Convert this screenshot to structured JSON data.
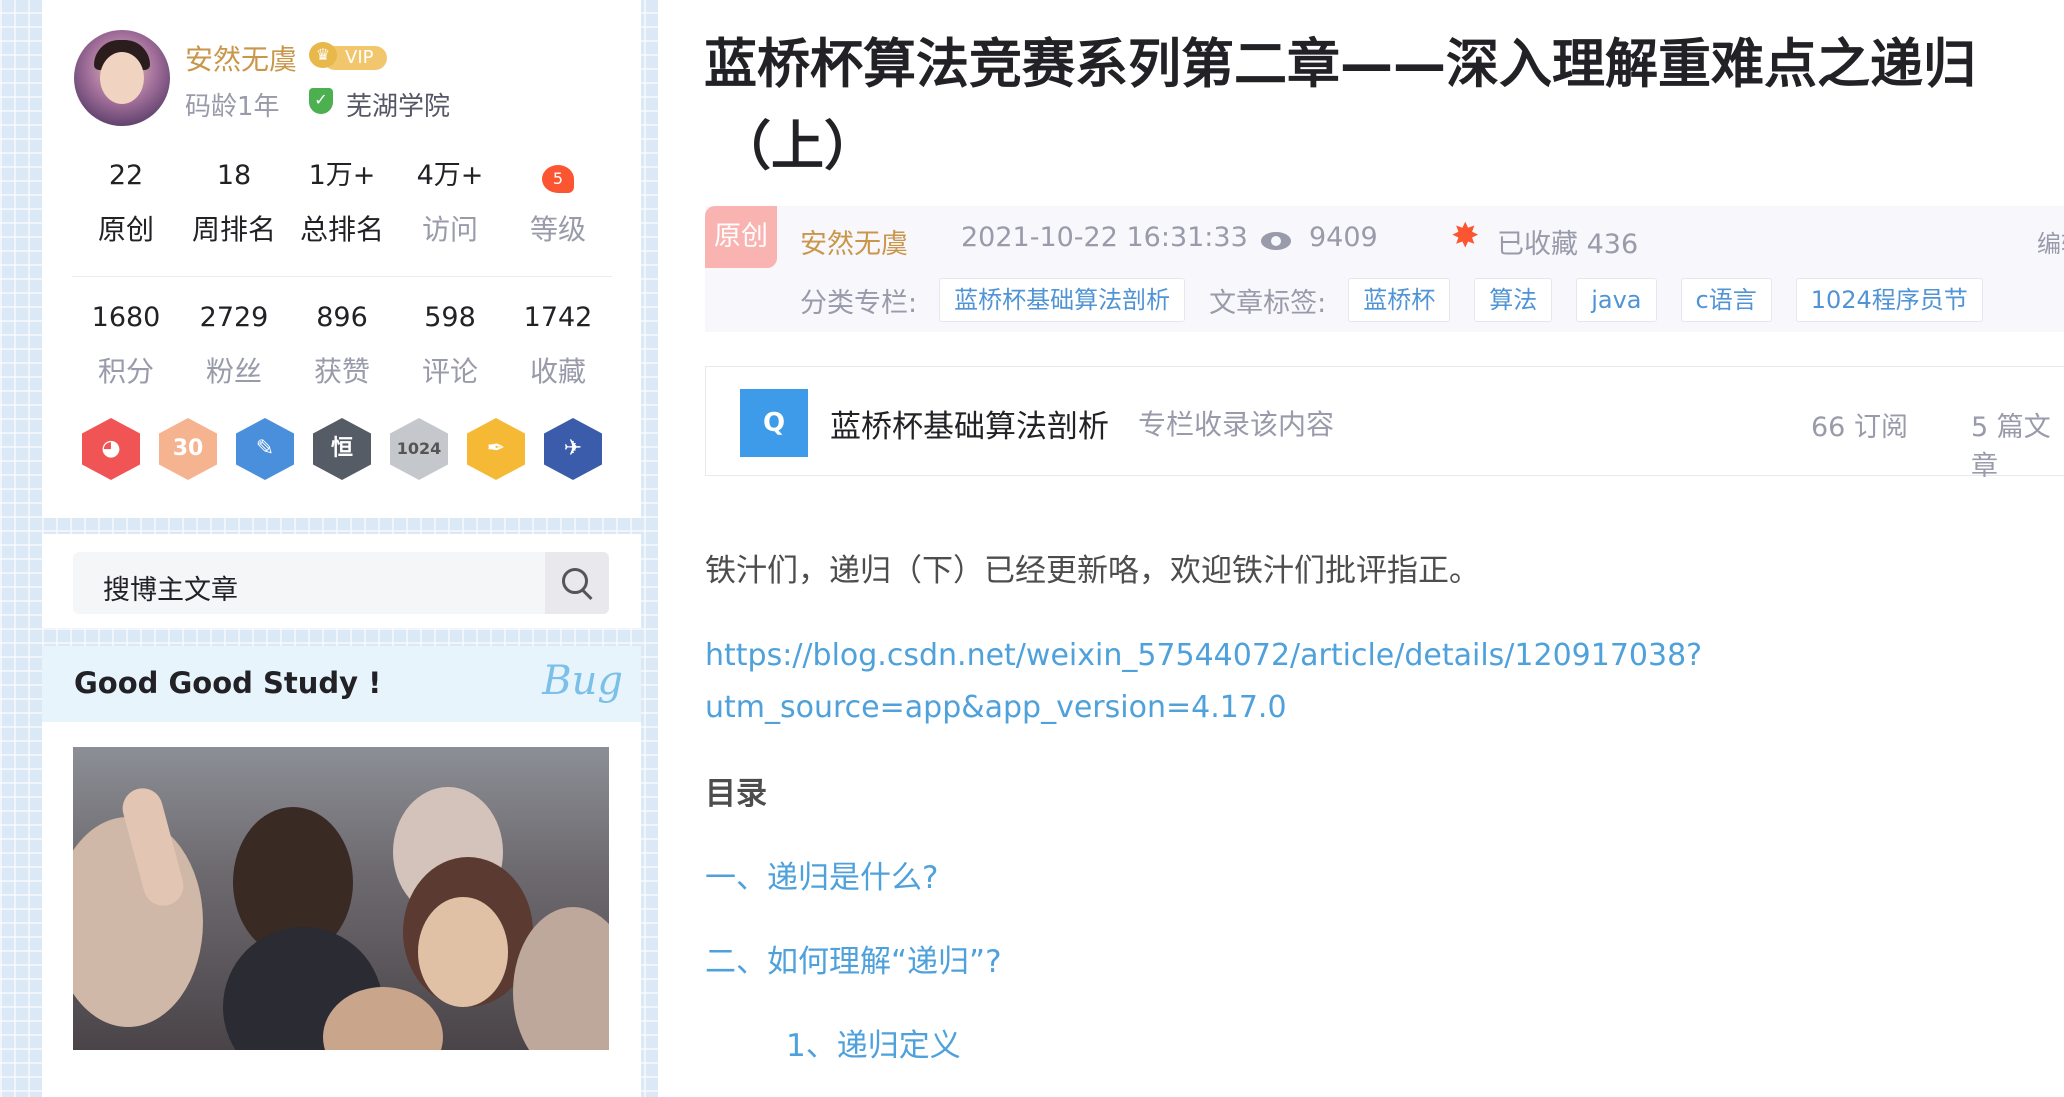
{
  "profile": {
    "name": "安然无虞",
    "vip": "VIP",
    "crown_glyph": "♛",
    "shield_glyph": "✓",
    "code_age": "码龄1年",
    "school": "芜湖学院",
    "stats_row1": [
      {
        "num": "22",
        "label": "原创"
      },
      {
        "num": "18",
        "label": "周排名"
      },
      {
        "num": "1万+",
        "label": "总排名"
      },
      {
        "num": "4万+",
        "label": "访问"
      },
      {
        "num": "",
        "label": "等级"
      }
    ],
    "stats_row2": [
      {
        "num": "1680",
        "label": "积分"
      },
      {
        "num": "2729",
        "label": "粉丝"
      },
      {
        "num": "896",
        "label": "获赞"
      },
      {
        "num": "598",
        "label": "评论"
      },
      {
        "num": "1742",
        "label": "收藏"
      }
    ],
    "level_icon_text": "5",
    "badges": [
      {
        "icon": "monkey-badge-icon",
        "text": "◕",
        "color": "#f05454"
      },
      {
        "icon": "anniversary-30-badge-icon",
        "text": "30",
        "color": "#f6b38f"
      },
      {
        "icon": "certificate-badge-icon",
        "text": "✎",
        "color": "#4a8fdc"
      },
      {
        "icon": "perseverance-badge-icon",
        "text": "恒",
        "color": "#565c66"
      },
      {
        "icon": "1024-badge-icon",
        "text": "1024",
        "color": "#c4c7cc"
      },
      {
        "icon": "pen-badge-icon",
        "text": "✒",
        "color": "#f5b935"
      },
      {
        "icon": "rocket-badge-icon",
        "text": "✈",
        "color": "#3a5caa"
      }
    ]
  },
  "search": {
    "placeholder": "搜博主文章"
  },
  "study": {
    "title": "Good Good Study !",
    "bug_text": "Bug"
  },
  "article": {
    "title_line1": "蓝桥杯算法竞赛系列第二章——深入理解重难点之递归",
    "title_line2": "（上）",
    "original_badge": "原创",
    "author": "安然无虞",
    "date": "2021-10-22 16:31:33",
    "views": "9409",
    "favorites": "已收藏 436",
    "edit": "编辑 ｜",
    "category_label": "分类专栏:",
    "categories": [
      "蓝桥杯基础算法剖析"
    ],
    "tags_label": "文章标签:",
    "tags": [
      "蓝桥杯",
      "算法",
      "java",
      "c语言",
      "1024程序员节"
    ],
    "column": {
      "icon_text": "Q",
      "name": "蓝桥杯基础算法剖析",
      "desc": "专栏收录该内容",
      "subscribers": "66 订阅",
      "article_count": "5 篇文章"
    },
    "paragraph": "铁汁们，递归（下）已经更新咯，欢迎铁汁们批评指正。",
    "link": "https://blog.csdn.net/weixin_57544072/article/details/120917038?utm_source=app&app_version=4.17.0",
    "toc_title": "目录",
    "toc": [
      "一、递归是什么?",
      "二、如何理解“递归”?",
      "1、递归定义"
    ]
  },
  "colors": {
    "accent_gold": "#c9964a",
    "link_blue": "#4ea1db",
    "csdn_red": "#fc5531",
    "background": "#dbe9f6"
  }
}
